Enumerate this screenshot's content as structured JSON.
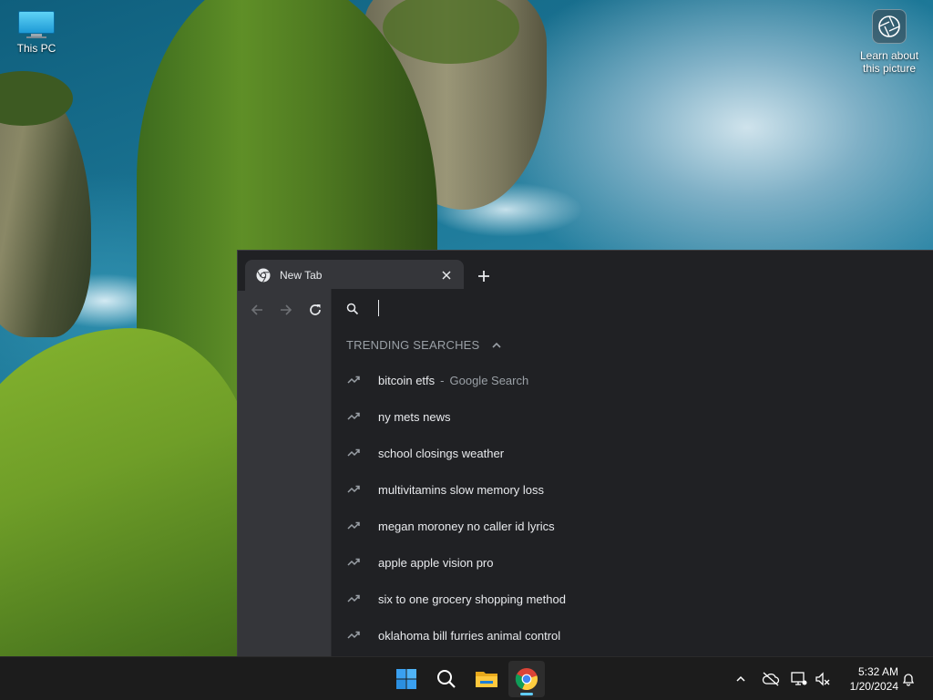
{
  "desktop": {
    "icons": [
      {
        "label": "This PC",
        "icon": "monitor-icon"
      },
      {
        "label_line1": "Learn about",
        "label_line2": "this picture",
        "icon": "camera-lens-icon"
      }
    ]
  },
  "browser": {
    "tab": {
      "title": "New Tab",
      "favicon": "chrome-icon"
    },
    "toolbar": {
      "back": "back-arrow-icon",
      "forward": "forward-arrow-icon",
      "reload": "reload-icon"
    },
    "omnibox": {
      "value": "",
      "placeholder": "",
      "section_header": "TRENDING SEARCHES",
      "suggestions": [
        {
          "text": "bitcoin etfs",
          "separator": "-",
          "suffix": "Google Search"
        },
        {
          "text": "ny mets news"
        },
        {
          "text": "school closings weather"
        },
        {
          "text": "multivitamins slow memory loss"
        },
        {
          "text": "megan moroney no caller id lyrics"
        },
        {
          "text": "apple apple vision pro"
        },
        {
          "text": "six to one grocery shopping method"
        },
        {
          "text": "oklahoma bill furries animal control"
        }
      ]
    }
  },
  "taskbar": {
    "apps": [
      "windows-start-icon",
      "search-icon",
      "file-explorer-icon",
      "chrome-icon"
    ],
    "active_app": "chrome",
    "clock": {
      "time": "5:32 AM",
      "date": "1/20/2024"
    }
  },
  "colors": {
    "accent": "#60cdff",
    "omnibox_bg": "#202124",
    "toolbar_bg": "#35363a"
  }
}
